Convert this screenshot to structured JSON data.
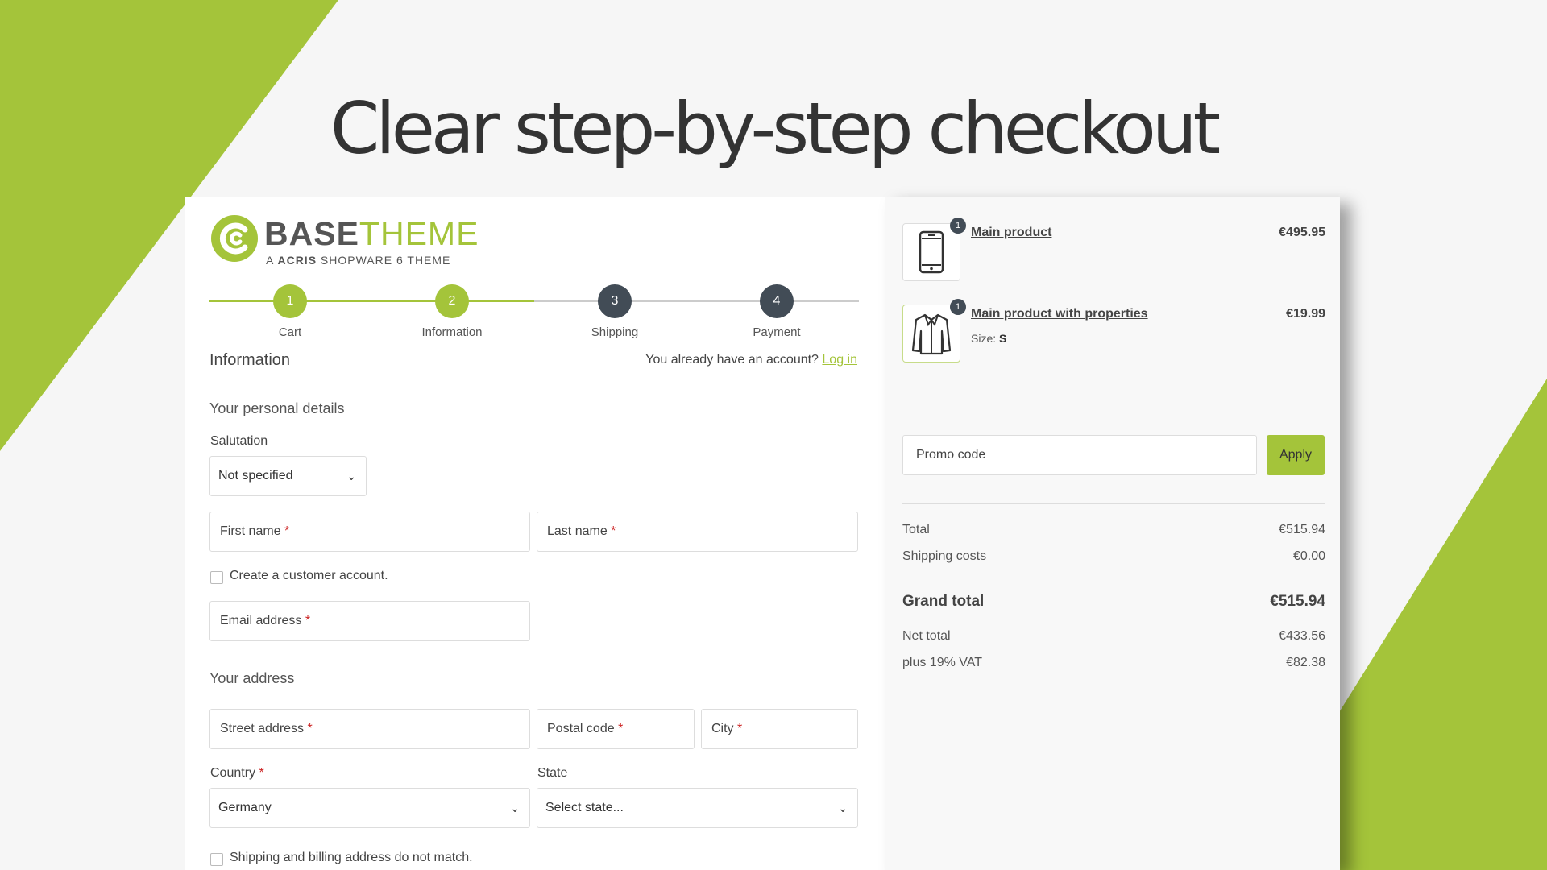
{
  "headline": "Clear step-by-step checkout",
  "logo": {
    "title_main": "BASE",
    "title_accent": "THEME",
    "subtitle_pre": "A ",
    "subtitle_brand": "ACRIS",
    "subtitle_post": " SHOPWARE 6 THEME"
  },
  "steps": [
    {
      "number": "1",
      "label": "Cart",
      "status": "done"
    },
    {
      "number": "2",
      "label": "Information",
      "status": "done"
    },
    {
      "number": "3",
      "label": "Shipping",
      "status": "todo"
    },
    {
      "number": "4",
      "label": "Payment",
      "status": "todo"
    }
  ],
  "info": {
    "title": "Information",
    "account_prompt": "You already have an account?",
    "login_link": "Log in"
  },
  "personal": {
    "title": "Your personal details",
    "salutation_label": "Salutation",
    "salutation_value": "Not specified",
    "first_name": "First name",
    "last_name": "Last name",
    "create_account": "Create a customer account.",
    "email": "Email address"
  },
  "address": {
    "title": "Your address",
    "street": "Street address",
    "postal": "Postal code",
    "city": "City",
    "country_label": "Country",
    "country_value": "Germany",
    "state_label": "State",
    "state_value": "Select state...",
    "different_billing": "Shipping and billing address do not match."
  },
  "required_mark": "*",
  "cart": {
    "items": [
      {
        "icon": "smartphone-icon",
        "quantity": "1",
        "name": "Main product",
        "price": "€495.95"
      },
      {
        "icon": "jacket-icon",
        "quantity": "1",
        "name": "Main product with properties",
        "price": "€19.99",
        "property_label": "Size:",
        "property_value": "S"
      }
    ],
    "promo_placeholder": "Promo code",
    "apply_label": "Apply",
    "summary": {
      "total_label": "Total",
      "total_value": "€515.94",
      "shipping_label": "Shipping costs",
      "shipping_value": "€0.00",
      "grand_label": "Grand total",
      "grand_value": "€515.94",
      "net_label": "Net total",
      "net_value": "€433.56",
      "vat_label": "plus 19% VAT",
      "vat_value": "€82.38"
    }
  },
  "colors": {
    "accent": "#a4c43a",
    "dark_step": "#424c56"
  }
}
